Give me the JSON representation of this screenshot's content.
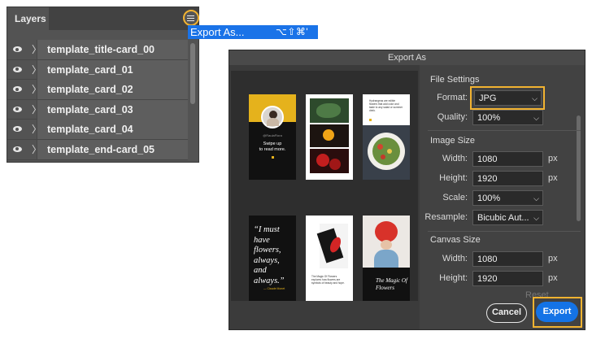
{
  "layers_panel": {
    "tab_label": "Layers",
    "items": [
      {
        "name": "template_title-card_00"
      },
      {
        "name": "template_card_01"
      },
      {
        "name": "template_card_02"
      },
      {
        "name": "template_card_03"
      },
      {
        "name": "template_card_04"
      },
      {
        "name": "template_end-card_05"
      }
    ]
  },
  "context_menu": {
    "item_label": "Export As...",
    "shortcut": "⌥⇧⌘'"
  },
  "dialog": {
    "title": "Export As",
    "preview_cards": {
      "card0_text": "Swipe up\nto read more.",
      "card0_handle": "@RaulaFlora",
      "card2_text": "Hydrangeas are edible flowers that add color and taste to any salad or summer drink.",
      "card3_quote": "“I must have flowers, always, and always.”",
      "card3_attrib": "— Claude Monet",
      "card4_text": "The Magic Of Flowers explores how flowers are symbols of beauty and hope.",
      "card5_text": "The Magic Of Flowers"
    },
    "file_settings": {
      "title": "File Settings",
      "format_label": "Format:",
      "format_value": "JPG",
      "quality_label": "Quality:",
      "quality_value": "100%"
    },
    "image_size": {
      "title": "Image Size",
      "width_label": "Width:",
      "width_value": "1080",
      "height_label": "Height:",
      "height_value": "1920",
      "scale_label": "Scale:",
      "scale_value": "100%",
      "resample_label": "Resample:",
      "resample_value": "Bicubic Aut...",
      "unit": "px"
    },
    "canvas_size": {
      "title": "Canvas Size",
      "width_label": "Width:",
      "width_value": "1080",
      "height_label": "Height:",
      "height_value": "1920",
      "unit": "px",
      "reset_label": "Reset"
    },
    "buttons": {
      "cancel": "Cancel",
      "export": "Export"
    }
  },
  "colors": {
    "highlight": "#f2b331",
    "accent_blue": "#1473e6",
    "menu_blue": "#1a73e8"
  }
}
